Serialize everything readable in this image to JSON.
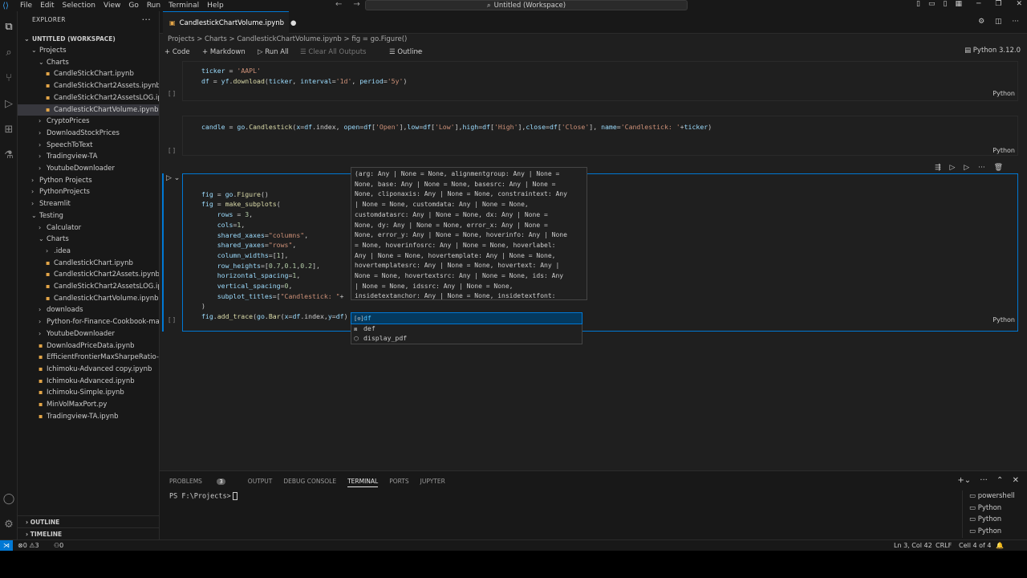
{
  "titlebar": {
    "menus": [
      "File",
      "Edit",
      "Selection",
      "View",
      "Go",
      "Run",
      "Terminal",
      "Help"
    ],
    "search": "Untitled (Workspace)"
  },
  "explorer": {
    "title": "EXPLORER",
    "workspace": "UNTITLED (WORKSPACE)",
    "items": [
      {
        "label": "Projects",
        "depth": 1,
        "kind": "folder-open"
      },
      {
        "label": "Charts",
        "depth": 2,
        "kind": "folder-open"
      },
      {
        "label": "CandleStickChart.ipynb",
        "depth": 3,
        "kind": "file"
      },
      {
        "label": "CandleStickChart2Assets.ipynb",
        "depth": 3,
        "kind": "file"
      },
      {
        "label": "CandleStickChart2AssetsLOG.ipynb",
        "depth": 3,
        "kind": "file"
      },
      {
        "label": "CandlestickChartVolume.ipynb",
        "depth": 3,
        "kind": "file",
        "selected": true
      },
      {
        "label": "CryptoPrices",
        "depth": 2,
        "kind": "folder"
      },
      {
        "label": "DownloadStockPrices",
        "depth": 2,
        "kind": "folder"
      },
      {
        "label": "SpeechToText",
        "depth": 2,
        "kind": "folder"
      },
      {
        "label": "Tradingview-TA",
        "depth": 2,
        "kind": "folder"
      },
      {
        "label": "YoutubeDownloader",
        "depth": 2,
        "kind": "folder"
      },
      {
        "label": "Python Projects",
        "depth": 1,
        "kind": "folder"
      },
      {
        "label": "PythonProjects",
        "depth": 1,
        "kind": "folder"
      },
      {
        "label": "Streamlit",
        "depth": 1,
        "kind": "folder"
      },
      {
        "label": "Testing",
        "depth": 1,
        "kind": "folder-open"
      },
      {
        "label": "Calculator",
        "depth": 2,
        "kind": "folder"
      },
      {
        "label": "Charts",
        "depth": 2,
        "kind": "folder-open"
      },
      {
        "label": ".idea",
        "depth": 3,
        "kind": "folder"
      },
      {
        "label": "CandlestickChart.ipynb",
        "depth": 3,
        "kind": "file"
      },
      {
        "label": "CandlestickChart2Assets.ipynb",
        "depth": 3,
        "kind": "file"
      },
      {
        "label": "CandleStickChart2AssetsLOG.ipynb",
        "depth": 3,
        "kind": "file"
      },
      {
        "label": "CandlestickChartVolume.ipynb",
        "depth": 3,
        "kind": "file"
      },
      {
        "label": "downloads",
        "depth": 2,
        "kind": "folder"
      },
      {
        "label": "Python-for-Finance-Cookbook-mas...",
        "depth": 2,
        "kind": "folder"
      },
      {
        "label": "YoutubeDownloader",
        "depth": 2,
        "kind": "folder"
      },
      {
        "label": "DownloadPriceData.ipynb",
        "depth": 2,
        "kind": "file"
      },
      {
        "label": "EfficientFrontierMaxSharpeRatio-M...",
        "depth": 2,
        "kind": "file"
      },
      {
        "label": "Ichimoku-Advanced copy.ipynb",
        "depth": 2,
        "kind": "file"
      },
      {
        "label": "Ichimoku-Advanced.ipynb",
        "depth": 2,
        "kind": "file"
      },
      {
        "label": "Ichimoku-Simple.ipynb",
        "depth": 2,
        "kind": "file"
      },
      {
        "label": "MinVolMaxPort.py",
        "depth": 2,
        "kind": "file"
      },
      {
        "label": "Tradingview-TA.ipynb",
        "depth": 2,
        "kind": "file"
      }
    ],
    "outline": "OUTLINE",
    "timeline": "TIMELINE"
  },
  "editor": {
    "tab": "CandlestickChartVolume.ipynb",
    "breadcrumb": "Projects > Charts > CandlestickChartVolume.ipynb > fig = go.Figure()",
    "toolbar": {
      "code": "+ Code",
      "markdown": "+ Markdown",
      "run_all": "Run All",
      "clear": "Clear All Outputs",
      "outline": "Outline",
      "more": "···"
    },
    "kernel": "Python 3.12.0",
    "cells": [
      {
        "exec": "[ ]",
        "lang": "Python",
        "lines": [
          "ticker = 'AAPL'",
          "df = yf.download(ticker, interval='1d', period='5y')"
        ]
      },
      {
        "exec": "[ ]",
        "lang": "Python",
        "lines": [
          "candle = go.Candlestick(x=df.index, open=df['Open'],low=df['Low'],high=df['High'],close=df['Close'], name='Candlestick: '+ticker)"
        ]
      },
      {
        "exec": "[ ]",
        "lang": "Python",
        "lines": [
          "fig = go.Figure()",
          "fig = make_subplots(",
          "    rows = 3,",
          "    cols=1,",
          "    shared_xaxes=\"columns\",",
          "    shared_yaxes=\"rows\",",
          "    column_widths=[1],",
          "    row_heights=[0.7,0.1,0.2],",
          "    horizontal_spacing=1,",
          "    vertical_spacing=0,",
          "    subplot_titles=[\"Candlestick: \"+",
          "  )",
          "fig.add_trace(go.Bar(x=df.index,y=df)"
        ]
      }
    ],
    "hover_lines": [
      "(arg: Any | None = None, alignmentgroup: Any | None =",
      "None, base: Any | None = None, basesrc: Any | None =",
      "None, cliponaxis: Any | None = None, constraintext: Any",
      "| None = None, customdata: Any | None = None,",
      "customdatasrc: Any | None = None, dx: Any | None =",
      "None, dy: Any | None = None, error_x: Any | None =",
      "None, error_y: Any | None = None, hoverinfo: Any | None",
      "= None, hoverinfosrc: Any | None = None, hoverlabel:",
      "Any | None = None, hovertemplate: Any | None = None,",
      "hovertemplatesrc: Any | None = None, hovertext: Any |",
      "None = None, hovertextsrc: Any | None = None, ids: Any",
      "| None = None, idssrc: Any | None = None,",
      "insidetextanchor: Any | None = None, insidetextfont:"
    ],
    "suggestions": [
      "df",
      "def",
      "display_pdf"
    ]
  },
  "panel": {
    "tabs": [
      "PROBLEMS",
      "OUTPUT",
      "DEBUG CONSOLE",
      "TERMINAL",
      "PORTS",
      "JUPYTER"
    ],
    "problems_count": "3",
    "prompt": "PS F:\\Projects>",
    "terminals": [
      "powershell",
      "Python",
      "Python",
      "Python"
    ]
  },
  "status": {
    "errors": "0",
    "warnings": "3",
    "ports": "0",
    "position": "Ln 3, Col 42",
    "eol": "CRLF",
    "cell": "Cell 4 of 4"
  }
}
